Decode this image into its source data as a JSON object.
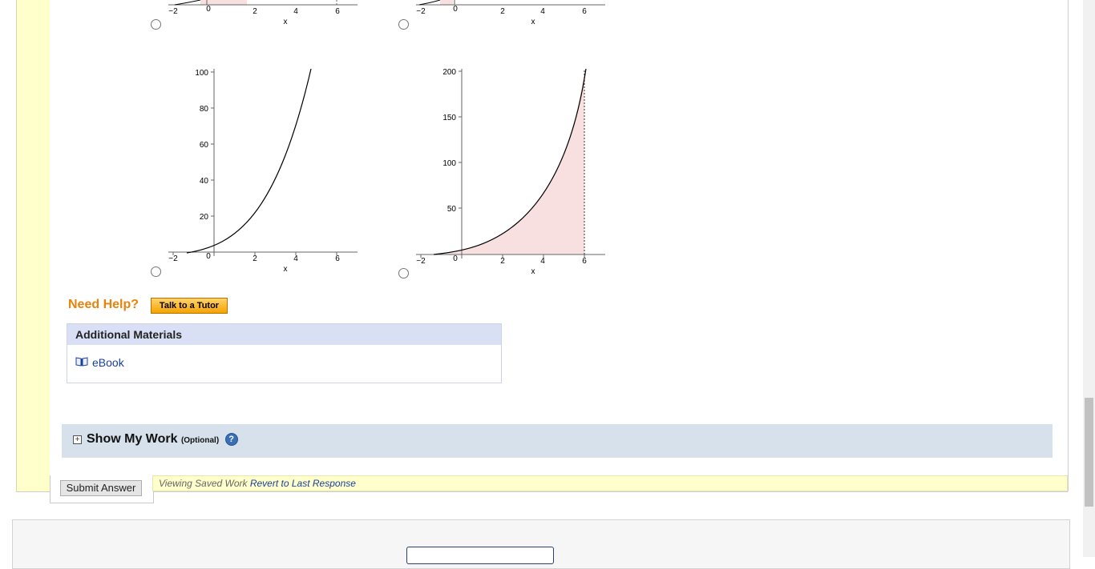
{
  "graphs": {
    "top_left": {
      "x_ticks": [
        "−2",
        "0",
        "2",
        "4",
        "6"
      ],
      "x_label": "x"
    },
    "top_right": {
      "x_ticks": [
        "−2",
        "0",
        "2",
        "4",
        "6"
      ],
      "x_label": "x"
    },
    "bottom_left": {
      "y_ticks": [
        "100",
        "80",
        "60",
        "40",
        "20"
      ],
      "x_ticks": [
        "−2",
        "0",
        "2",
        "4",
        "6"
      ],
      "x_label": "x"
    },
    "bottom_right": {
      "y_ticks": [
        "200",
        "150",
        "100",
        "50"
      ],
      "x_ticks": [
        "−2",
        "0",
        "2",
        "4",
        "6"
      ],
      "x_label": "x"
    }
  },
  "help": {
    "heading": "Need Help?",
    "tutor_button": "Talk to a Tutor"
  },
  "materials": {
    "heading": "Additional Materials",
    "ebook_label": "eBook"
  },
  "show_my_work": {
    "toggle": "+",
    "title": "Show My Work",
    "optional": "(Optional)",
    "help": "?"
  },
  "submit": {
    "button_label": "Submit Answer"
  },
  "saved": {
    "status": "Viewing Saved Work",
    "revert_link": "Revert to Last Response"
  },
  "colors": {
    "accent_orange": "#e8830b",
    "shade_fill": "#f8e0e0",
    "link": "#1a3f99"
  }
}
